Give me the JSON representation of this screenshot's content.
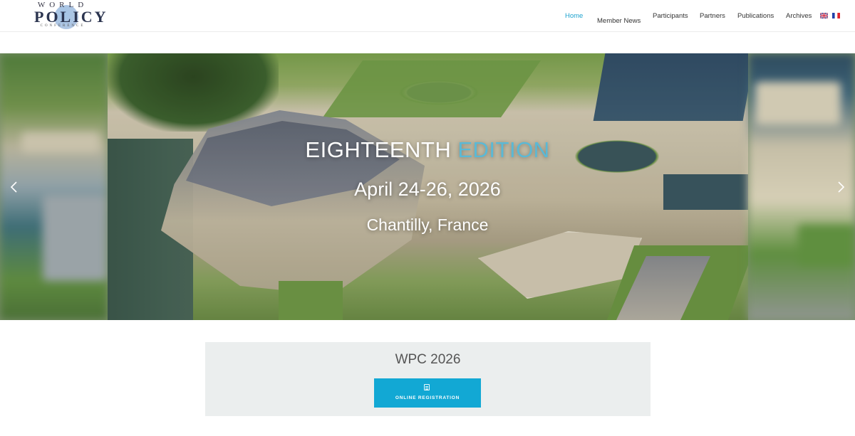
{
  "logo": {
    "line1": "WORLD",
    "line2": "POLICY",
    "line3": "CONFERENCE"
  },
  "nav": {
    "items": [
      {
        "label": "Home",
        "active": true
      },
      {
        "label": "Member News",
        "active": false
      },
      {
        "label": "Participants",
        "active": false
      },
      {
        "label": "Partners",
        "active": false
      },
      {
        "label": "Publications",
        "active": false
      },
      {
        "label": "Archives",
        "active": false
      }
    ],
    "languages": [
      "english-flag-icon",
      "french-flag-icon"
    ]
  },
  "slider": {
    "title_main": "EIGHTEENTH",
    "title_accent": "EDITION",
    "date": "April 24-26, 2026",
    "place": "Chantilly, France",
    "prev_icon": "chevron-left-icon",
    "next_icon": "chevron-right-icon"
  },
  "section": {
    "title": "WPC 2026",
    "button_label": "ONLINE REGISTRATION",
    "button_icon": "document-icon"
  },
  "colors": {
    "accent": "#1fa3cf",
    "button": "#12a8d4",
    "title_accent": "#5ab9d6",
    "panel_bg": "#ebeeee"
  }
}
